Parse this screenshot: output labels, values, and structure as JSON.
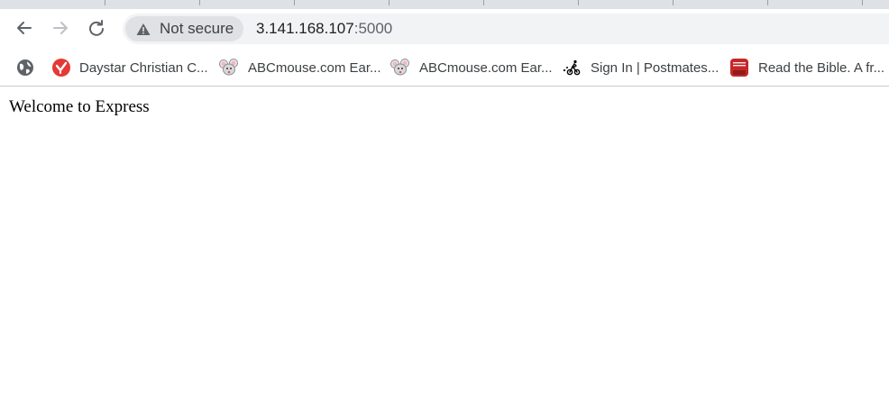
{
  "browser": {
    "nav": {
      "back_icon": "arrow-left-icon",
      "forward_icon": "arrow-right-icon",
      "reload_icon": "reload-icon"
    },
    "address_bar": {
      "security_label": "Not secure",
      "security_icon": "warning-triangle-icon",
      "host": "3.141.168.107",
      "port": ":5000"
    },
    "bookmarks": [
      {
        "label": "",
        "icon": "globe-icon"
      },
      {
        "label": "Daystar Christian C...",
        "icon": "daystar-logo-icon"
      },
      {
        "label": "ABCmouse.com Ear...",
        "icon": "mouse-icon"
      },
      {
        "label": "ABCmouse.com Ear...",
        "icon": "mouse-icon"
      },
      {
        "label": "Sign In | Postmates...",
        "icon": "postmates-icon"
      },
      {
        "label": "Read the Bible. A fr...",
        "icon": "bible-app-icon"
      }
    ],
    "colors": {
      "chrome_bg": "#ffffff",
      "omnibox_bg": "#f1f3f4",
      "chip_bg": "#dfe1e5",
      "tabstrip_bg": "#dee1e6",
      "daystar_red": "#e53935",
      "bible_red": "#c62828"
    }
  },
  "page": {
    "body_text": "Welcome to Express"
  }
}
